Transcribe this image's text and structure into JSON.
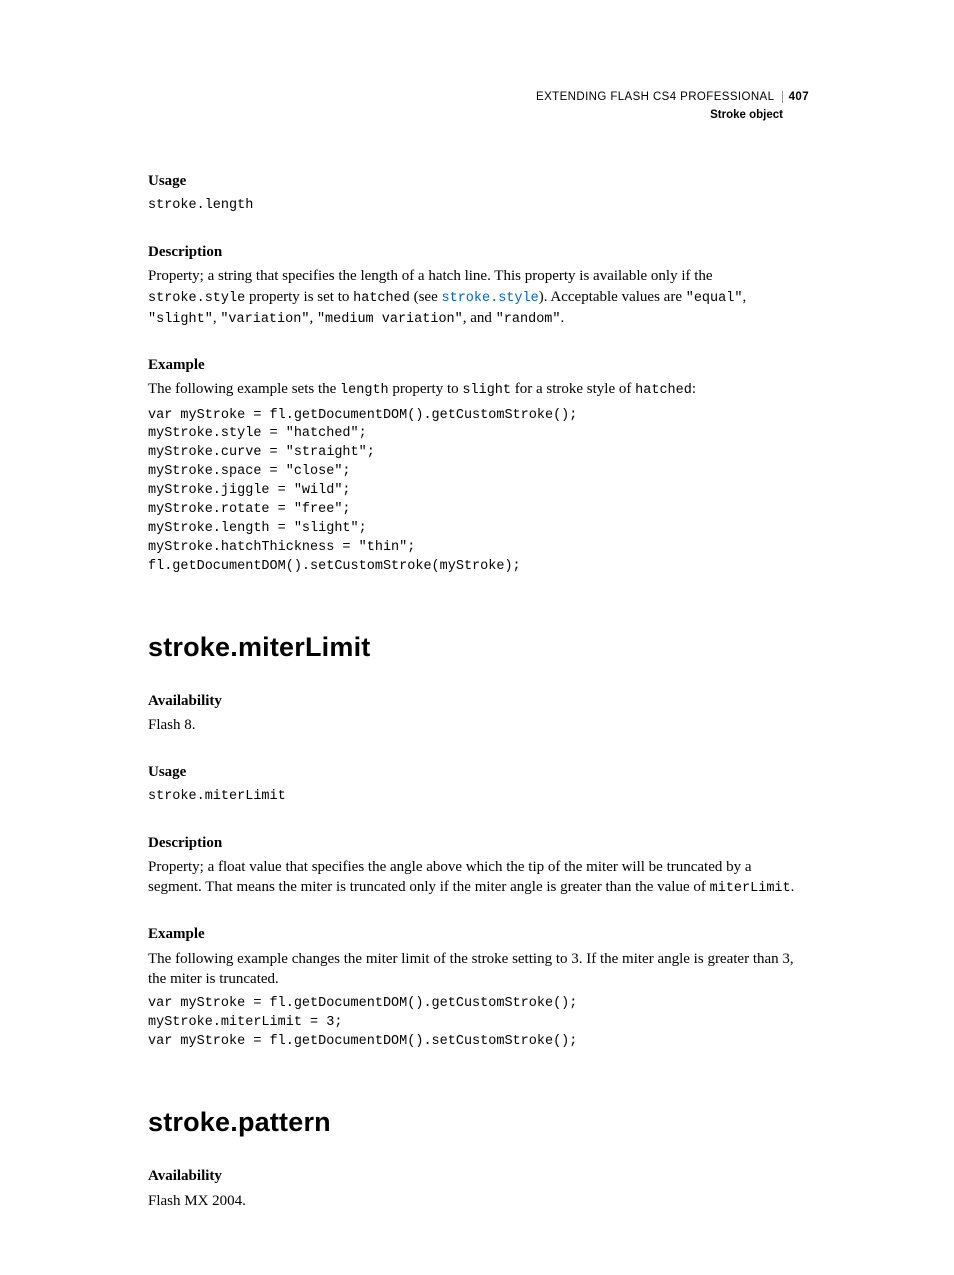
{
  "header": {
    "doc_title": "EXTENDING FLASH CS4 PROFESSIONAL",
    "page_number": "407",
    "section": "Stroke object"
  },
  "length": {
    "usage_h": "Usage",
    "usage_code": "stroke.length",
    "desc_h": "Description",
    "desc_p1a": "Property; a string that specifies the length of a hatch line. This property is available only if the ",
    "desc_p1b": "stroke.style",
    "desc_p1c": " property is set to ",
    "desc_p1d": "hatched",
    "desc_p1e": " (see ",
    "desc_link": "stroke.style",
    "desc_p1f": "). Acceptable values are ",
    "desc_v1": "\"equal\"",
    "desc_c1": ", ",
    "desc_v2": "\"slight\"",
    "desc_c2": ", ",
    "desc_v3": "\"variation\"",
    "desc_c3": ", ",
    "desc_v4": "\"medium variation\"",
    "desc_c4": ", and ",
    "desc_v5": "\"random\"",
    "desc_p1g": ".",
    "ex_h": "Example",
    "ex_p_a": "The following example sets the ",
    "ex_p_b": "length",
    "ex_p_c": " property to ",
    "ex_p_d": "slight",
    "ex_p_e": " for a stroke style of ",
    "ex_p_f": "hatched",
    "ex_p_g": ":",
    "ex_code": "var myStroke = fl.getDocumentDOM().getCustomStroke();\nmyStroke.style = \"hatched\";\nmyStroke.curve = \"straight\";\nmyStroke.space = \"close\";\nmyStroke.jiggle = \"wild\";\nmyStroke.rotate = \"free\";\nmyStroke.length = \"slight\";\nmyStroke.hatchThickness = \"thin\";\nfl.getDocumentDOM().setCustomStroke(myStroke);"
  },
  "miterLimit": {
    "title": "stroke.miterLimit",
    "avail_h": "Availability",
    "avail_v": "Flash 8.",
    "usage_h": "Usage",
    "usage_code": "stroke.miterLimit",
    "desc_h": "Description",
    "desc_p_a": "Property; a float value that specifies the angle above which the tip of the miter will be truncated by a segment. That means the miter is truncated only if the miter angle is greater than the value of ",
    "desc_p_b": "miterLimit",
    "desc_p_c": ".",
    "ex_h": "Example",
    "ex_p": "The following example changes the miter limit of the stroke setting to 3. If the miter angle is greater than 3, the miter is truncated.",
    "ex_code": "var myStroke = fl.getDocumentDOM().getCustomStroke();\nmyStroke.miterLimit = 3;\nvar myStroke = fl.getDocumentDOM().setCustomStroke();"
  },
  "pattern": {
    "title": "stroke.pattern",
    "avail_h": "Availability",
    "avail_v": "Flash MX 2004."
  }
}
